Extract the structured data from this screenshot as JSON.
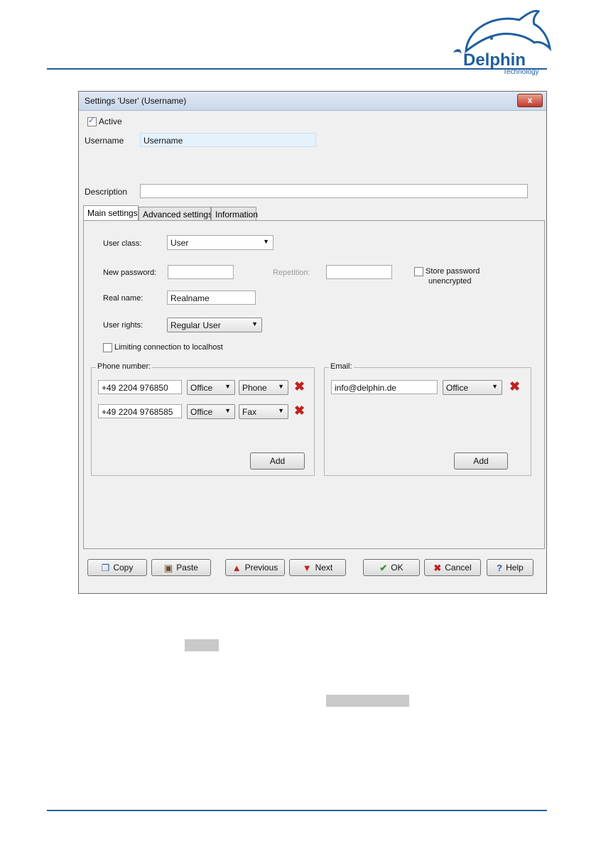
{
  "brand": {
    "name": "Delphin",
    "tagline": "Technology",
    "color": "#1f5f9e"
  },
  "dialog": {
    "title": "Settings 'User' (Username)",
    "close_label": "x",
    "active": {
      "label": "Active",
      "checked": true
    },
    "username": {
      "label": "Username",
      "value": "Username"
    },
    "description": {
      "label": "Description",
      "value": ""
    },
    "tabs": [
      {
        "label": "Main settings",
        "active": true
      },
      {
        "label": "Advanced settings",
        "active": false
      },
      {
        "label": "Information",
        "active": false
      }
    ],
    "main": {
      "user_class": {
        "label": "User class:",
        "value": "User"
      },
      "new_password": {
        "label": "New password:",
        "value": ""
      },
      "repetition": {
        "label": "Repetition:",
        "value": ""
      },
      "store_password": {
        "label_line1": "Store password",
        "label_line2": "unencrypted",
        "checked": false
      },
      "real_name": {
        "label": "Real name:",
        "value": "Realname"
      },
      "user_rights": {
        "label": "User rights:",
        "value": "Regular User"
      },
      "limit_localhost": {
        "label": "Limiting connection to localhost",
        "checked": false
      },
      "phone": {
        "legend": "Phone number:",
        "rows": [
          {
            "number": "+49 2204 976850",
            "location": "Office",
            "type": "Phone"
          },
          {
            "number": "+49 2204 9768585",
            "location": "Office",
            "type": "Fax"
          }
        ],
        "add_label": "Add"
      },
      "email": {
        "legend": "Email:",
        "rows": [
          {
            "address": "info@delphin.de",
            "location": "Office"
          }
        ],
        "add_label": "Add"
      }
    },
    "buttons": {
      "copy": "Copy",
      "paste": "Paste",
      "previous": "Previous",
      "next": "Next",
      "ok": "OK",
      "cancel": "Cancel",
      "help": "Help"
    }
  }
}
